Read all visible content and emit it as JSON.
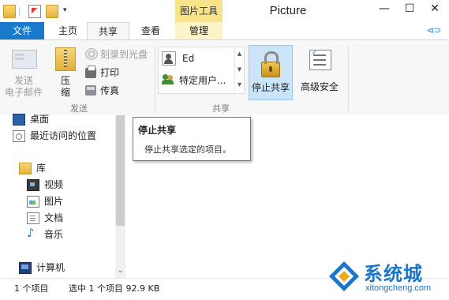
{
  "window": {
    "title": "Picture",
    "contextual_tab_group": "图片工具",
    "controls": {
      "minimize": "—",
      "maximize": "☐",
      "close": "✕"
    }
  },
  "ribbon_tabs": {
    "file": "文件",
    "home": "主页",
    "share": "共享",
    "view": "查看",
    "manage": "管理",
    "help_glyph": "⊲⊃"
  },
  "ribbon": {
    "send_group": {
      "label": "发送",
      "email_line1": "发送",
      "email_line2": "电子邮件",
      "zip_line1": "压",
      "zip_line2": "缩",
      "burn": "刻录到光盘",
      "print": "打印",
      "fax": "传真"
    },
    "share_group": {
      "label": "共享",
      "user": "Ed",
      "specific_users": "特定用户...",
      "scroll_up": "▲",
      "scroll_down": "▼",
      "scroll_more": "▾",
      "stop_sharing": "停止共享",
      "advanced_security": "高级安全"
    }
  },
  "nav": {
    "desktop": "桌面",
    "recent": "最近访问的位置",
    "library": "库",
    "videos": "视频",
    "pictures": "图片",
    "documents": "文档",
    "music": "音乐",
    "computer": "计算机",
    "scroll_down": "⌄"
  },
  "tooltip": {
    "title": "停止共享",
    "description": "停止共享选定的项目。"
  },
  "status": {
    "item_count": "1 个项目",
    "selected": "选中 1 个项目  92.9 KB"
  },
  "watermark": {
    "brand": "系统城",
    "url": "xitongcheng.com"
  },
  "colors": {
    "file_tab": "#1979ca",
    "contextual_header": "#f7e38a",
    "selected_button": "#cce4f7",
    "watermark": "#1a76c7"
  }
}
